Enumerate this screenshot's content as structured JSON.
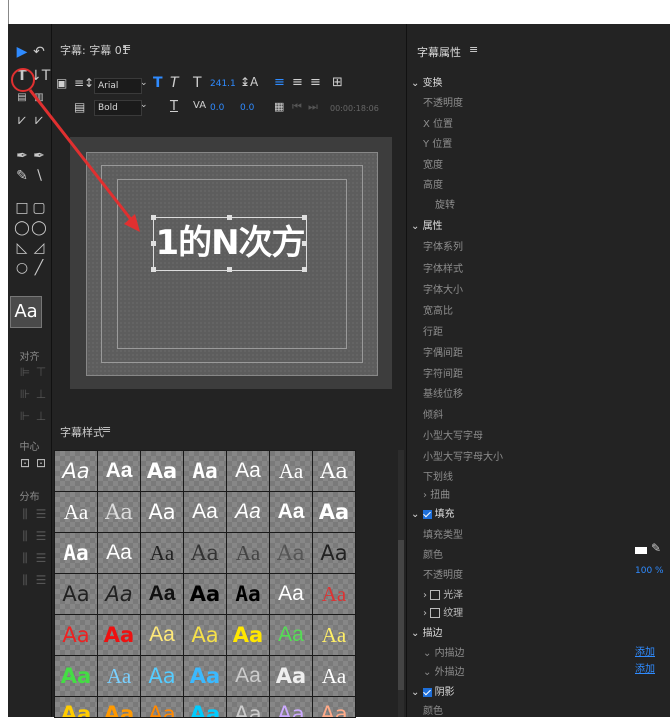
{
  "title_panel": {
    "tab_title": "字幕: 字幕 01",
    "tab_menu": "≡"
  },
  "toolbar": {
    "font_family": "Arial",
    "font_style": "Bold",
    "font_size": "241.1",
    "kerning_value": "0.0",
    "tracking_value": "0.0",
    "timecode": "00:00:18:06"
  },
  "canvas": {
    "text": "1的N次方"
  },
  "styles_panel": {
    "header": "字幕样式",
    "menu": "≡",
    "samples": [
      [
        "Aa",
        "Aa",
        "Aa",
        "Aa",
        "Aa",
        "Aa",
        "Aa"
      ],
      [
        "Aa",
        "Aa",
        "Aa",
        "Aa",
        "Aa",
        "Aa",
        "Aa"
      ],
      [
        "Aa",
        "Aa",
        "Aa",
        "Aa",
        "Aa",
        "Aa",
        "Aa"
      ],
      [
        "Aa",
        "Aa",
        "Aa",
        "Aa",
        "Aa",
        "Aa",
        "Aa"
      ],
      [
        "Aa",
        "Aa",
        "Aa",
        "Aa",
        "Aa",
        "Aa",
        "Aa"
      ],
      [
        "Aa",
        "Aa",
        "Aa",
        "Aa",
        "Aa",
        "Aa",
        "Aa"
      ],
      [
        "Aa",
        "Aa",
        "Aa",
        "Aa",
        "Aa",
        "Aa",
        "Aa"
      ]
    ]
  },
  "tools_panel": {
    "preview": "Aa",
    "align_label": "对齐",
    "center_label": "中心",
    "distribute_label": "分布"
  },
  "properties": {
    "header": "字幕属性",
    "menu": "≡",
    "transform": "变换",
    "opacity": "不透明度",
    "x_pos": "X 位置",
    "y_pos": "Y 位置",
    "width": "宽度",
    "height": "高度",
    "rotation": "旋转",
    "attributes": "属性",
    "font_family": "字体系列",
    "font_style": "字体样式",
    "font_size": "字体大小",
    "aspect": "宽高比",
    "leading": "行距",
    "kerning": "字偶间距",
    "tracking": "字符间距",
    "baseline": "基线位移",
    "slant": "倾斜",
    "small_caps": "小型大写字母",
    "small_caps_size": "小型大写字母大小",
    "underline": "下划线",
    "distort": "扭曲",
    "fill": "填充",
    "fill_type": "填充类型",
    "color": "颜色",
    "fill_opacity": "不透明度",
    "fill_opacity_value": "100 %",
    "sheen": "光泽",
    "texture": "纹理",
    "strokes": "描边",
    "inner_stroke": "内描边",
    "outer_stroke": "外描边",
    "add_label": "添加",
    "shadow": "阴影",
    "shadow_color": "颜色"
  },
  "colors": {
    "accent": "#2f8bff",
    "annotation": "#e03030"
  }
}
